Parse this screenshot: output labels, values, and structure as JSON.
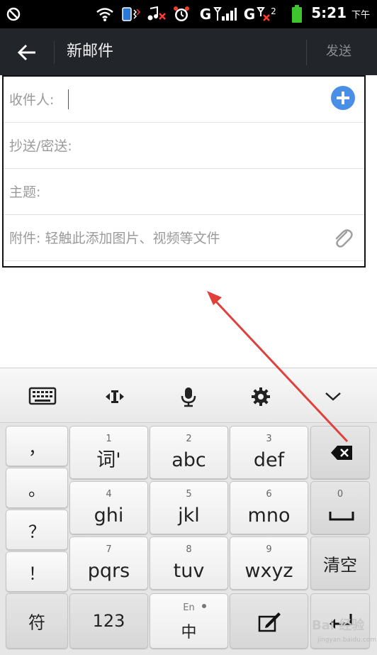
{
  "status_bar": {
    "time": "5:21",
    "ampm": "下午",
    "network_1": "G",
    "network_2": "G",
    "sim2_label": "2",
    "icons": [
      "alarm-off-icon",
      "wifi-icon",
      "vibrate-icon",
      "music-muted-icon",
      "alarm-clock-icon",
      "signal-icon",
      "signal-no-sim-icon",
      "battery-icon"
    ]
  },
  "header": {
    "title": "新邮件",
    "send_label": "发送"
  },
  "form": {
    "to_label": "收件人:",
    "cc_label": "抄送/密送:",
    "subject_label": "主题:",
    "attach_label": "附件: 轻触此添加图片、视频等文件"
  },
  "keyboard": {
    "toolbar_icons": [
      "keyboard-icon",
      "cursor-move-icon",
      "microphone-icon",
      "settings-icon",
      "collapse-icon"
    ],
    "side_keys": [
      "，",
      "。",
      "？",
      "！"
    ],
    "keys": [
      {
        "num": "1",
        "label": "词'"
      },
      {
        "num": "2",
        "label": "abc"
      },
      {
        "num": "3",
        "label": "def"
      },
      {
        "num": "4",
        "label": "ghi"
      },
      {
        "num": "5",
        "label": "jkl"
      },
      {
        "num": "6",
        "label": "mno"
      },
      {
        "num": "7",
        "label": "pqrs"
      },
      {
        "num": "8",
        "label": "tuv"
      },
      {
        "num": "9",
        "label": "wxyz"
      }
    ],
    "space_num": "0",
    "clear_label": "清空",
    "symbol_label": "符",
    "number_label": "123",
    "lang_top": "En",
    "lang_bottom": "中"
  },
  "watermark": {
    "brand": "Bai  经验",
    "url": "jingyan.baidu.com"
  },
  "colors": {
    "header_bg": "#222529",
    "accent_blue": "#4a8fe7",
    "annotation_red": "#e0403c",
    "status_green": "#3fc42f",
    "status_red": "#ff3b30"
  }
}
